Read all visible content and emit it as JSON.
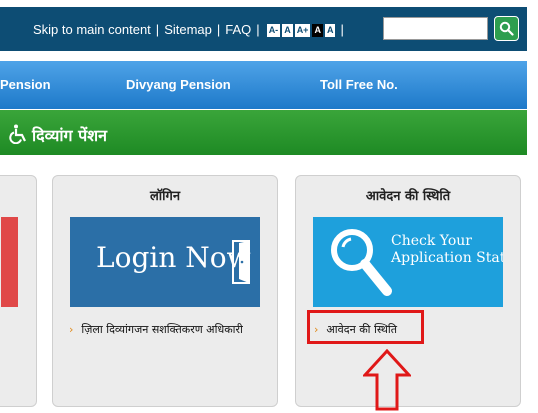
{
  "header": {
    "skip": "Skip to main content",
    "sitemap": "Sitemap",
    "faq": "FAQ",
    "separator": "|",
    "font_sizes": [
      "A-",
      "A",
      "A+",
      "A",
      "A"
    ]
  },
  "search": {
    "placeholder": "",
    "icon": "search-icon"
  },
  "nav": {
    "items": [
      "Pension",
      "Divyang Pension",
      "Toll Free No."
    ]
  },
  "page": {
    "title": "दिव्यांग पेंशन",
    "icon": "wheelchair-icon"
  },
  "cards": {
    "login": {
      "title": "लॉगिन",
      "banner_text": "Login Now",
      "link": "ज़िला दिव्यांगजन सशक्तिकरण अधिकारी"
    },
    "status": {
      "title": "आवेदन की स्थिति",
      "banner_line1": "Check Your",
      "banner_line2": "Application Status",
      "link": "आवेदन की स्थिति"
    }
  },
  "colors": {
    "header_bg": "#0d4d74",
    "nav_bg": "#1d79c9",
    "title_bg": "#2a9a2e",
    "highlight": "#e01818",
    "link_chevron": "#e08a1a"
  }
}
